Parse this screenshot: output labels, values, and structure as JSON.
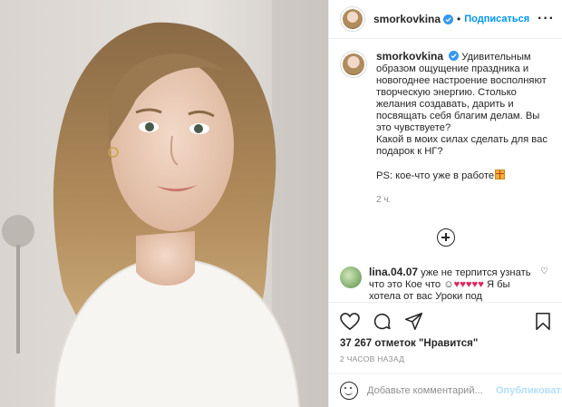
{
  "post": {
    "username": "smorkovkina",
    "follow_label": "Подписаться",
    "more_icon": "more-horizontal-icon",
    "caption_lines": "Удивительным\nобразом ощущение праздника и\nновогоднее настроение восполняют\nтворческую энергию. Столько\nжелания создавать, дарить и\nпосвящать себя благим делам. Вы\nэто чувствуете?\nКакой в моих силах сделать для вас\nподарок к НГ?",
    "ps_text": "PS: кое-что уже в работе",
    "caption_time": "2 ч.",
    "likes_text": "37 267 отметок \"Нравится\"",
    "ago_text": "2 ЧАСОВ НАЗАД"
  },
  "comment": {
    "username": "lina.04.07",
    "text_before": "уже не терпится узнать что это Кое что",
    "text_after": "Я бы хотела от вас Уроки под"
  },
  "composer": {
    "placeholder": "Добавьте комментарий...",
    "publish_label": "Опубликовать"
  },
  "colors": {
    "accent": "#0095f6",
    "verified": "#3897f0",
    "heart": "#e0245e",
    "publish_disabled": "#b2dffc"
  }
}
